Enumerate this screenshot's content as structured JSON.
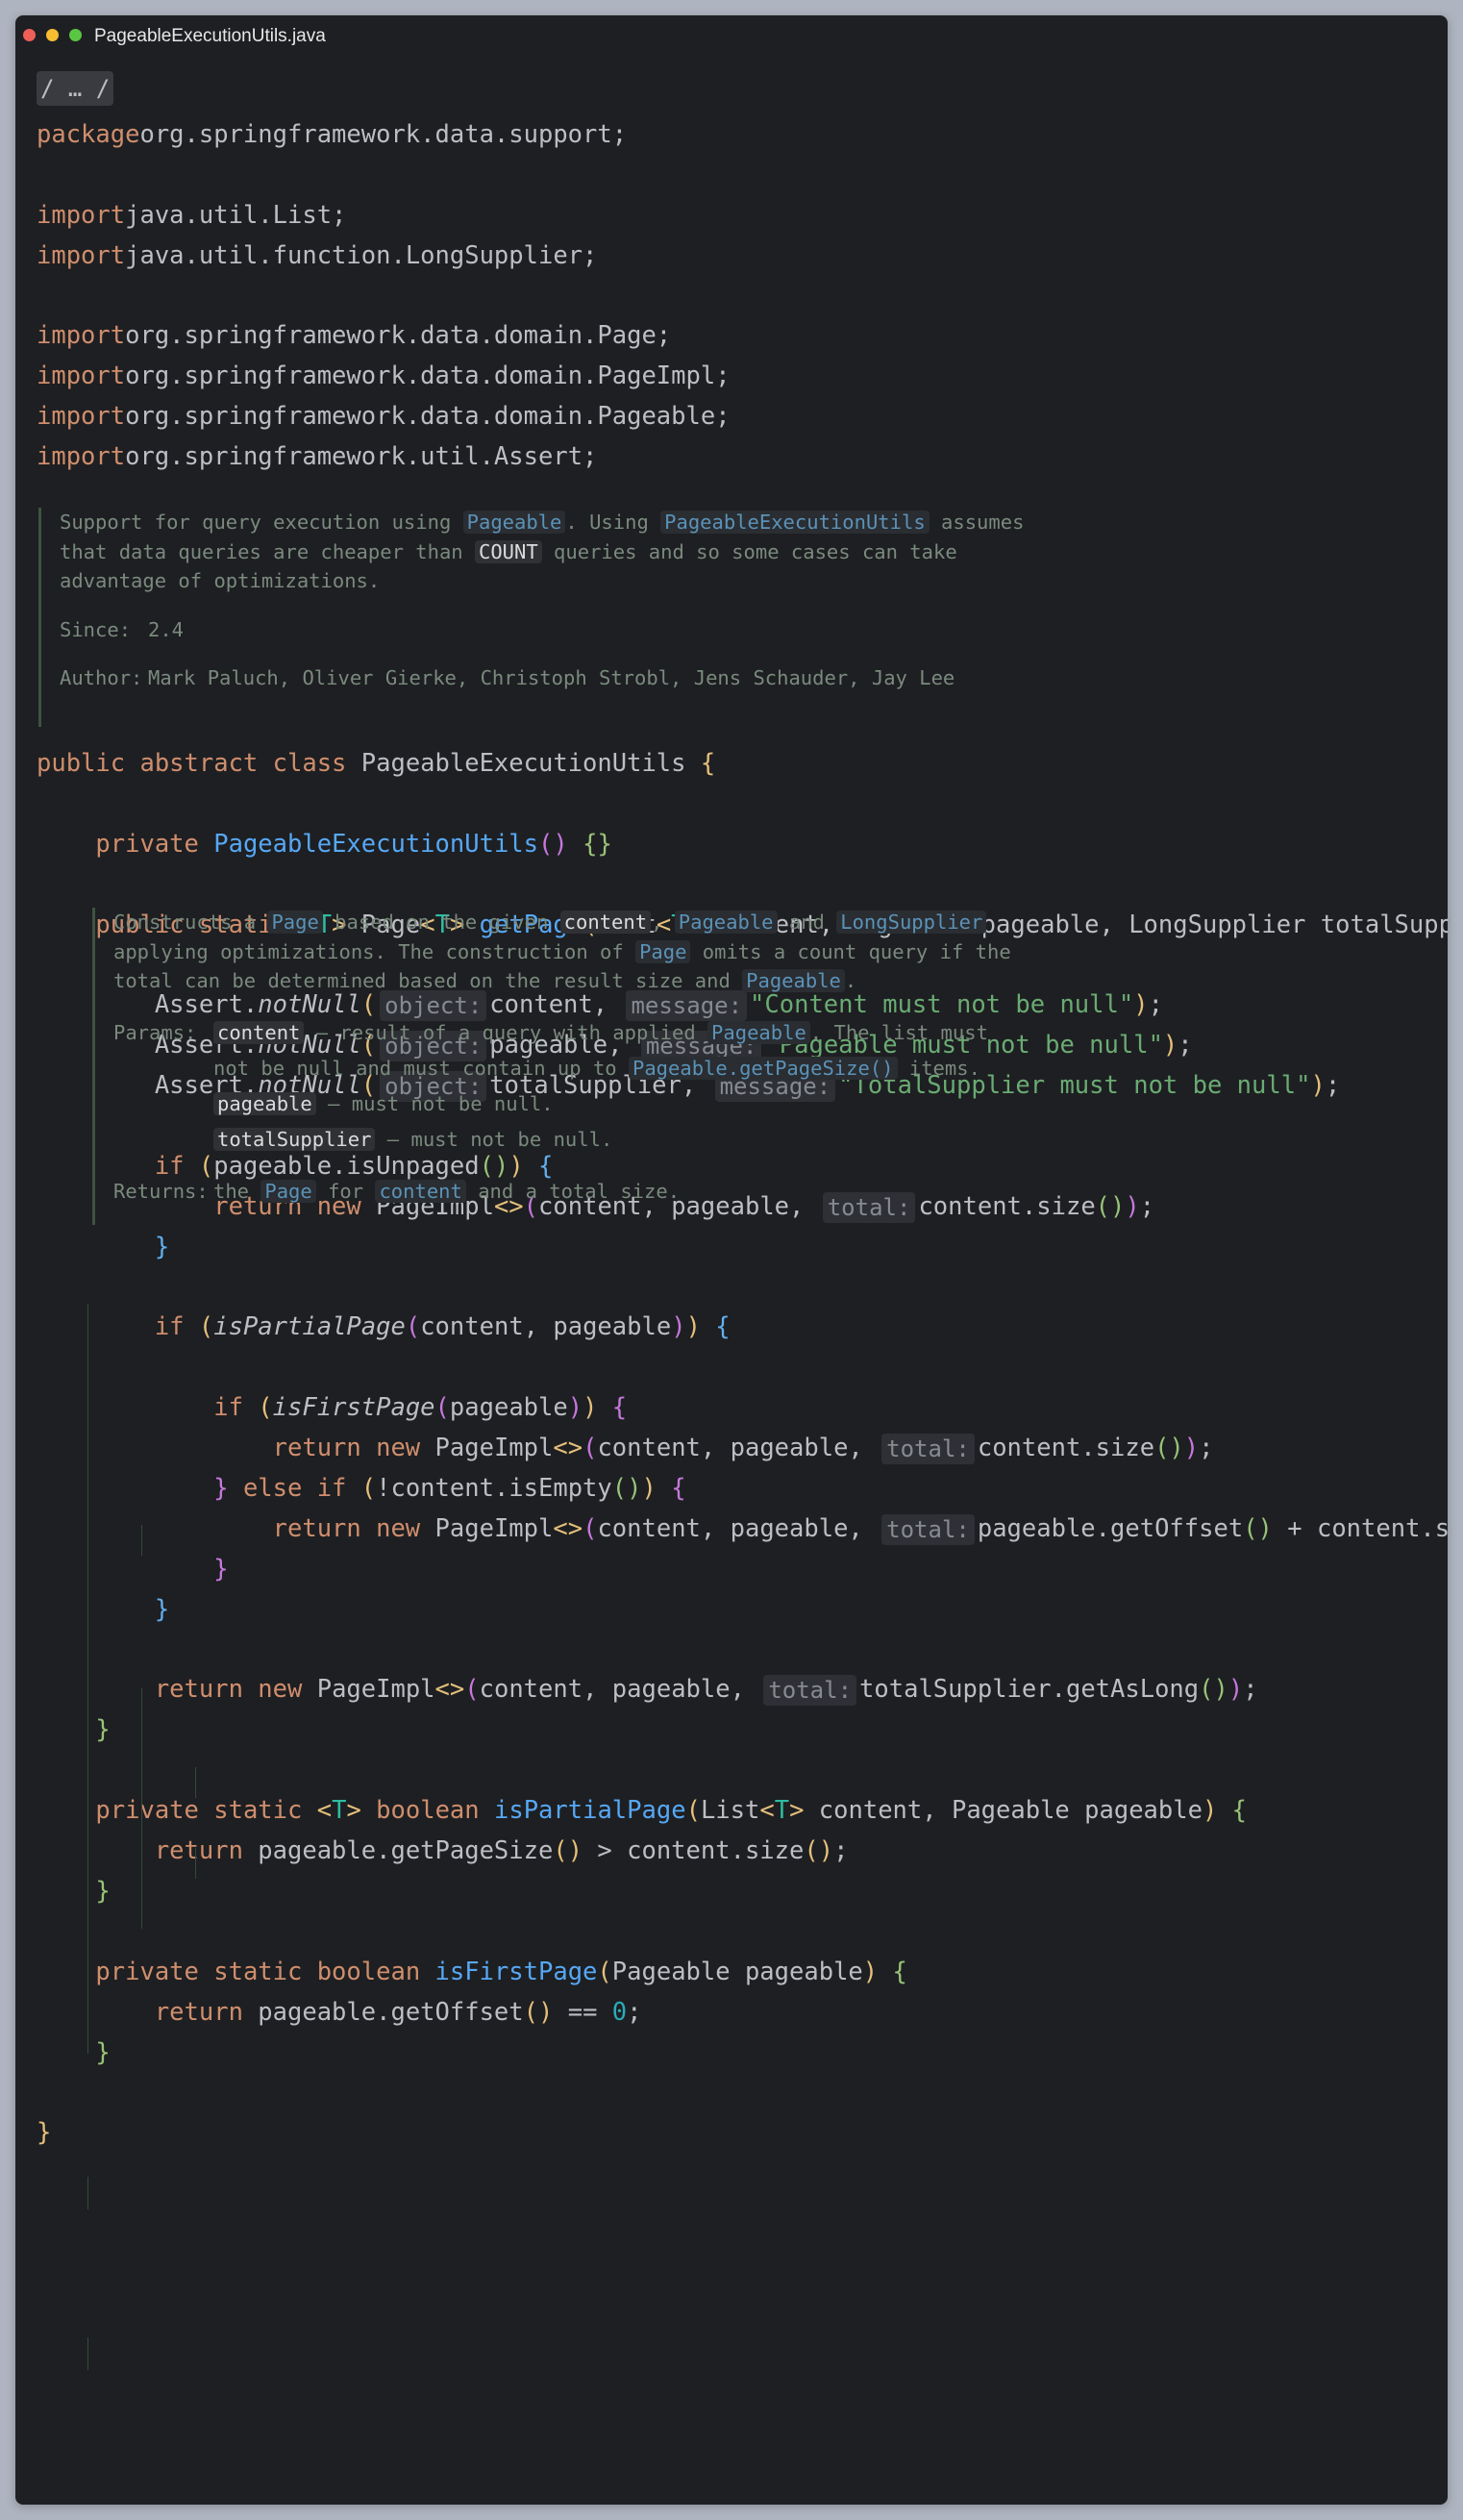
{
  "window": {
    "title": "PageableExecutionUtils.java"
  },
  "fold": {
    "label": "/ … /"
  },
  "header_lines": [
    [
      [
        "kw",
        "package"
      ],
      [
        "",
        "org.springframework.data.support;"
      ]
    ],
    [],
    [
      [
        "kw",
        "import"
      ],
      [
        "",
        "java.util.List;"
      ]
    ],
    [
      [
        "kw",
        "import"
      ],
      [
        "",
        "java.util.function.LongSupplier;"
      ]
    ],
    [],
    [
      [
        "kw",
        "import"
      ],
      [
        "",
        "org.springframework.data.domain.Page;"
      ]
    ],
    [
      [
        "kw",
        "import"
      ],
      [
        "",
        "org.springframework.data.domain.PageImpl;"
      ]
    ],
    [
      [
        "kw",
        "import"
      ],
      [
        "",
        "org.springframework.data.domain.Pageable;"
      ]
    ],
    [
      [
        "kw",
        "import"
      ],
      [
        "",
        "org.springframework.util.Assert;"
      ]
    ]
  ],
  "class_doc": {
    "lines": [
      [
        [
          "t",
          "Support for query execution using "
        ],
        [
          "c",
          "Pageable"
        ],
        [
          "t",
          ". Using "
        ],
        [
          "c",
          "PageableExecutionUtils"
        ],
        [
          "t",
          " assumes"
        ]
      ],
      [
        [
          "t",
          "that data queries are cheaper than "
        ],
        [
          "w",
          "COUNT"
        ],
        [
          "t",
          " queries and so some cases can take"
        ]
      ],
      [
        [
          "t",
          "advantage of optimizations."
        ]
      ]
    ],
    "since_label": "Since:",
    "since_value": "2.4",
    "author_label": "Author:",
    "author_value": "Mark Paluch, Oliver Gierke, Christoph Strobl, Jens Schauder, Jay Lee"
  },
  "method_doc": {
    "lines": [
      [
        [
          "t",
          "Constructs a "
        ],
        [
          "c",
          "Page"
        ],
        [
          "t",
          " based on the given "
        ],
        [
          "w",
          "content"
        ],
        [
          "t",
          ", "
        ],
        [
          "c",
          "Pageable"
        ],
        [
          "t",
          " and "
        ],
        [
          "c",
          "LongSupplier"
        ]
      ],
      [
        [
          "t",
          "applying optimizations. The construction of "
        ],
        [
          "c",
          "Page"
        ],
        [
          "t",
          " omits a count query if the"
        ]
      ],
      [
        [
          "t",
          "total can be determined based on the result size and "
        ],
        [
          "c",
          "Pageable"
        ],
        [
          "t",
          "."
        ]
      ]
    ],
    "params_label": "Params:",
    "params": [
      [
        [
          "w",
          "content"
        ],
        [
          "t",
          " – result of a query with applied "
        ],
        [
          "c",
          "Pageable"
        ],
        [
          "t",
          ". The list must"
        ]
      ],
      [
        [
          "t",
          "not be null and must contain up to "
        ],
        [
          "c",
          "Pageable.getPageSize()"
        ],
        [
          "t",
          " items."
        ]
      ],
      [
        [
          "w",
          "pageable"
        ],
        [
          "t",
          " – must not be null."
        ]
      ],
      [
        [
          "w",
          "totalSupplier"
        ],
        [
          "t",
          " – must not be null."
        ]
      ]
    ],
    "returns_label": "Returns:",
    "returns": [
      [
        "t",
        "the "
      ],
      [
        "c",
        "Page"
      ],
      [
        "t",
        " for "
      ],
      [
        "c",
        "content"
      ],
      [
        "t",
        " and a total size."
      ]
    ]
  },
  "code_lines": [
    [
      [
        "kw",
        "public abstract class "
      ],
      [
        "",
        "PageableExecutionUtils "
      ],
      [
        "p1",
        "{"
      ]
    ],
    [],
    [
      [
        "",
        "    "
      ],
      [
        "kw",
        "private "
      ],
      [
        "fn",
        "PageableExecutionUtils"
      ],
      [
        "p2",
        "()"
      ],
      [
        "p4",
        " {}"
      ]
    ],
    [],
    [
      [
        "",
        "    "
      ],
      [
        "kw",
        "public static "
      ],
      [
        "p1",
        "<"
      ],
      [
        "typ",
        "T"
      ],
      [
        "p1",
        "> "
      ],
      [
        "",
        "Page"
      ],
      [
        "p1",
        "<"
      ],
      [
        "typ",
        "T"
      ],
      [
        "p1",
        "> "
      ],
      [
        "fn",
        "getPage"
      ],
      [
        "p1",
        "("
      ],
      [
        "",
        "List"
      ],
      [
        "p1",
        "<"
      ],
      [
        "typ",
        "T"
      ],
      [
        "p1",
        "> "
      ],
      [
        "",
        "content, Pageable pageable, LongSupplier totalSupplier"
      ],
      [
        "p1",
        ")"
      ],
      [
        "p4",
        " {"
      ]
    ],
    [],
    [
      [
        "",
        "        Assert."
      ],
      [
        "it",
        "notNull"
      ],
      [
        "p1",
        "("
      ],
      [
        "hint",
        "object:"
      ],
      [
        "",
        "content, "
      ],
      [
        "hint",
        "message:"
      ],
      [
        "str",
        "\"Content must not be null\""
      ],
      [
        "p1",
        ")"
      ],
      [
        "",
        ";"
      ]
    ],
    [
      [
        "",
        "        Assert."
      ],
      [
        "it",
        "notNull"
      ],
      [
        "p1",
        "("
      ],
      [
        "hint",
        "object:"
      ],
      [
        "",
        "pageable, "
      ],
      [
        "hint",
        "message:"
      ],
      [
        "str",
        "\"Pageable must not be null\""
      ],
      [
        "p1",
        ")"
      ],
      [
        "",
        ";"
      ]
    ],
    [
      [
        "",
        "        Assert."
      ],
      [
        "it",
        "notNull"
      ],
      [
        "p1",
        "("
      ],
      [
        "hint",
        "object:"
      ],
      [
        "",
        "totalSupplier, "
      ],
      [
        "hint",
        "message:"
      ],
      [
        "str",
        "\"TotalSupplier must not be null\""
      ],
      [
        "p1",
        ")"
      ],
      [
        "",
        ";"
      ]
    ],
    [],
    [
      [
        "",
        "        "
      ],
      [
        "kw",
        "if "
      ],
      [
        "p1",
        "("
      ],
      [
        "",
        "pageable.isUnpaged"
      ],
      [
        "p4",
        "()"
      ],
      [
        "p1",
        ")"
      ],
      [
        "p3",
        " {"
      ]
    ],
    [
      [
        "",
        "            "
      ],
      [
        "kw",
        "return new "
      ],
      [
        "",
        "PageImpl"
      ],
      [
        "p1",
        "<>"
      ],
      [
        "p2",
        "("
      ],
      [
        "",
        "content, pageable, "
      ],
      [
        "hint",
        "total:"
      ],
      [
        "",
        "content.size"
      ],
      [
        "p4",
        "()"
      ],
      [
        "p2",
        ")"
      ],
      [
        "",
        ";"
      ]
    ],
    [
      [
        "",
        "        "
      ],
      [
        "p3",
        "}"
      ]
    ],
    [],
    [
      [
        "",
        "        "
      ],
      [
        "kw",
        "if "
      ],
      [
        "p1",
        "("
      ],
      [
        "it",
        "isPartialPage"
      ],
      [
        "p2",
        "("
      ],
      [
        "",
        "content, pageable"
      ],
      [
        "p2",
        ")"
      ],
      [
        "p1",
        ")"
      ],
      [
        "p3",
        " {"
      ]
    ],
    [],
    [
      [
        "",
        "            "
      ],
      [
        "kw",
        "if "
      ],
      [
        "p1",
        "("
      ],
      [
        "it",
        "isFirstPage"
      ],
      [
        "p2",
        "("
      ],
      [
        "",
        "pageable"
      ],
      [
        "p2",
        ")"
      ],
      [
        "p1",
        ")"
      ],
      [
        "p2",
        " {"
      ]
    ],
    [
      [
        "",
        "                "
      ],
      [
        "kw",
        "return new "
      ],
      [
        "",
        "PageImpl"
      ],
      [
        "p1",
        "<>"
      ],
      [
        "p2",
        "("
      ],
      [
        "",
        "content, pageable, "
      ],
      [
        "hint",
        "total:"
      ],
      [
        "",
        "content.size"
      ],
      [
        "p4",
        "()"
      ],
      [
        "p2",
        ")"
      ],
      [
        "",
        ";"
      ]
    ],
    [
      [
        "",
        "            "
      ],
      [
        "p2",
        "}"
      ],
      [
        "kw",
        " else if "
      ],
      [
        "p1",
        "("
      ],
      [
        "",
        "!content.isEmpty"
      ],
      [
        "p4",
        "()"
      ],
      [
        "p1",
        ")"
      ],
      [
        "p2",
        " {"
      ]
    ],
    [
      [
        "",
        "                "
      ],
      [
        "kw",
        "return new "
      ],
      [
        "",
        "PageImpl"
      ],
      [
        "p1",
        "<>"
      ],
      [
        "p2",
        "("
      ],
      [
        "",
        "content, pageable, "
      ],
      [
        "hint",
        "total:"
      ],
      [
        "",
        "pageable.getOffset"
      ],
      [
        "p4",
        "()"
      ],
      [
        "",
        " + content.size"
      ],
      [
        "p4",
        "()"
      ],
      [
        "p2",
        ")"
      ],
      [
        "",
        ";"
      ]
    ],
    [
      [
        "",
        "            "
      ],
      [
        "p2",
        "}"
      ]
    ],
    [
      [
        "",
        "        "
      ],
      [
        "p3",
        "}"
      ]
    ],
    [],
    [
      [
        "",
        "        "
      ],
      [
        "kw",
        "return new "
      ],
      [
        "",
        "PageImpl"
      ],
      [
        "p1",
        "<>"
      ],
      [
        "p2",
        "("
      ],
      [
        "",
        "content, pageable, "
      ],
      [
        "hint",
        "total:"
      ],
      [
        "",
        "totalSupplier.getAsLong"
      ],
      [
        "p4",
        "()"
      ],
      [
        "p2",
        ")"
      ],
      [
        "",
        ";"
      ]
    ],
    [
      [
        "",
        "    "
      ],
      [
        "p4",
        "}"
      ]
    ],
    [],
    [
      [
        "",
        "    "
      ],
      [
        "kw",
        "private static "
      ],
      [
        "p1",
        "<"
      ],
      [
        "typ",
        "T"
      ],
      [
        "p1",
        "> "
      ],
      [
        "kw",
        "boolean "
      ],
      [
        "fn",
        "isPartialPage"
      ],
      [
        "p1",
        "("
      ],
      [
        "",
        "List"
      ],
      [
        "p1",
        "<"
      ],
      [
        "typ",
        "T"
      ],
      [
        "p1",
        "> "
      ],
      [
        "",
        "content, Pageable pageable"
      ],
      [
        "p1",
        ")"
      ],
      [
        "p4",
        " {"
      ]
    ],
    [
      [
        "",
        "        "
      ],
      [
        "kw",
        "return "
      ],
      [
        "",
        "pageable.getPageSize"
      ],
      [
        "p1",
        "()"
      ],
      [
        "",
        " > content.size"
      ],
      [
        "p1",
        "()"
      ],
      [
        "",
        ";"
      ]
    ],
    [
      [
        "",
        "    "
      ],
      [
        "p4",
        "}"
      ]
    ],
    [],
    [
      [
        "",
        "    "
      ],
      [
        "kw",
        "private static boolean "
      ],
      [
        "fn",
        "isFirstPage"
      ],
      [
        "p1",
        "("
      ],
      [
        "",
        "Pageable pageable"
      ],
      [
        "p1",
        ")"
      ],
      [
        "p4",
        " {"
      ]
    ],
    [
      [
        "",
        "        "
      ],
      [
        "kw",
        "return "
      ],
      [
        "",
        "pageable.getOffset"
      ],
      [
        "p1",
        "()"
      ],
      [
        "",
        " == "
      ],
      [
        "num",
        "0"
      ],
      [
        "",
        ";"
      ]
    ],
    [
      [
        "",
        "    "
      ],
      [
        "p4",
        "}"
      ]
    ],
    [],
    [
      [
        "p1",
        "}"
      ]
    ]
  ]
}
